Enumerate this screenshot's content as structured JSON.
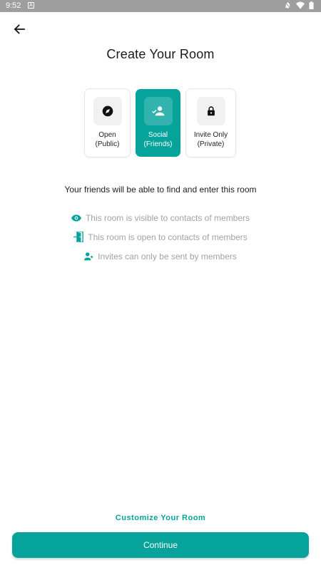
{
  "status_bar": {
    "time": "9:52",
    "notif_glyph": "A"
  },
  "header": {
    "title": "Create Your Room"
  },
  "options": [
    {
      "label": "Open\n(Public)",
      "icon": "compass-icon",
      "selected": false
    },
    {
      "label": "Social\n(Friends)",
      "icon": "person-check-icon",
      "selected": true
    },
    {
      "label": "Invite Only\n(Private)",
      "icon": "lock-icon",
      "selected": false
    }
  ],
  "description": "Your friends will be able to find and enter this room",
  "features": [
    {
      "text": "This room is visible to contacts of members",
      "icon": "eye-icon"
    },
    {
      "text": "This room is open to contacts of members",
      "icon": "door-open-icon"
    },
    {
      "text": "Invites can only be sent by members",
      "icon": "person-add-icon"
    }
  ],
  "actions": {
    "customize_label": "Customize Your Room",
    "continue_label": "Continue"
  },
  "colors": {
    "accent": "#06a39b",
    "status_bar": "#9e9e9e",
    "muted_text": "#a2a2a2"
  }
}
